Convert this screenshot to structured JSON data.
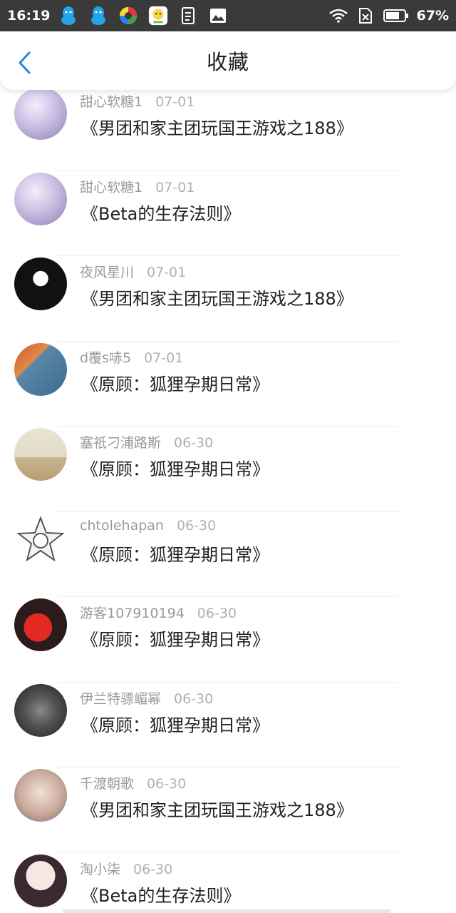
{
  "status_bar": {
    "time": "16:19",
    "battery_percent": "67%",
    "icons": [
      "qq-icon",
      "qq-icon",
      "app-icon",
      "app-icon",
      "document-icon",
      "image-icon",
      "wifi-icon",
      "sim-icon",
      "battery-icon"
    ]
  },
  "header": {
    "title": "收藏",
    "back_icon": "chevron-left-icon",
    "accent_color": "#1e88e5"
  },
  "items": [
    {
      "user": "甜心软糖1",
      "date": "07-01",
      "title": "《男团和家主团玩国王游戏之188》"
    },
    {
      "user": "甜心软糖1",
      "date": "07-01",
      "title": "《Beta的生存法则》"
    },
    {
      "user": "夜风星川",
      "date": "07-01",
      "title": "《男团和家主团玩国王游戏之188》"
    },
    {
      "user": "d覆s哧5",
      "date": "07-01",
      "title": "《原顾：狐狸孕期日常》"
    },
    {
      "user": "塞祇刁浦路斯",
      "date": "06-30",
      "title": "《原顾：狐狸孕期日常》"
    },
    {
      "user": "chtolehapan",
      "date": "06-30",
      "title": "《原顾：狐狸孕期日常》"
    },
    {
      "user": "游客107910194",
      "date": "06-30",
      "title": "《原顾：狐狸孕期日常》"
    },
    {
      "user": "伊兰特骠嵋幂",
      "date": "06-30",
      "title": "《原顾：狐狸孕期日常》"
    },
    {
      "user": "千渡朝歌",
      "date": "06-30",
      "title": "《男团和家主团玩国王游戏之188》"
    },
    {
      "user": "淘小柒",
      "date": "06-30",
      "title": "《Beta的生存法则》"
    }
  ]
}
